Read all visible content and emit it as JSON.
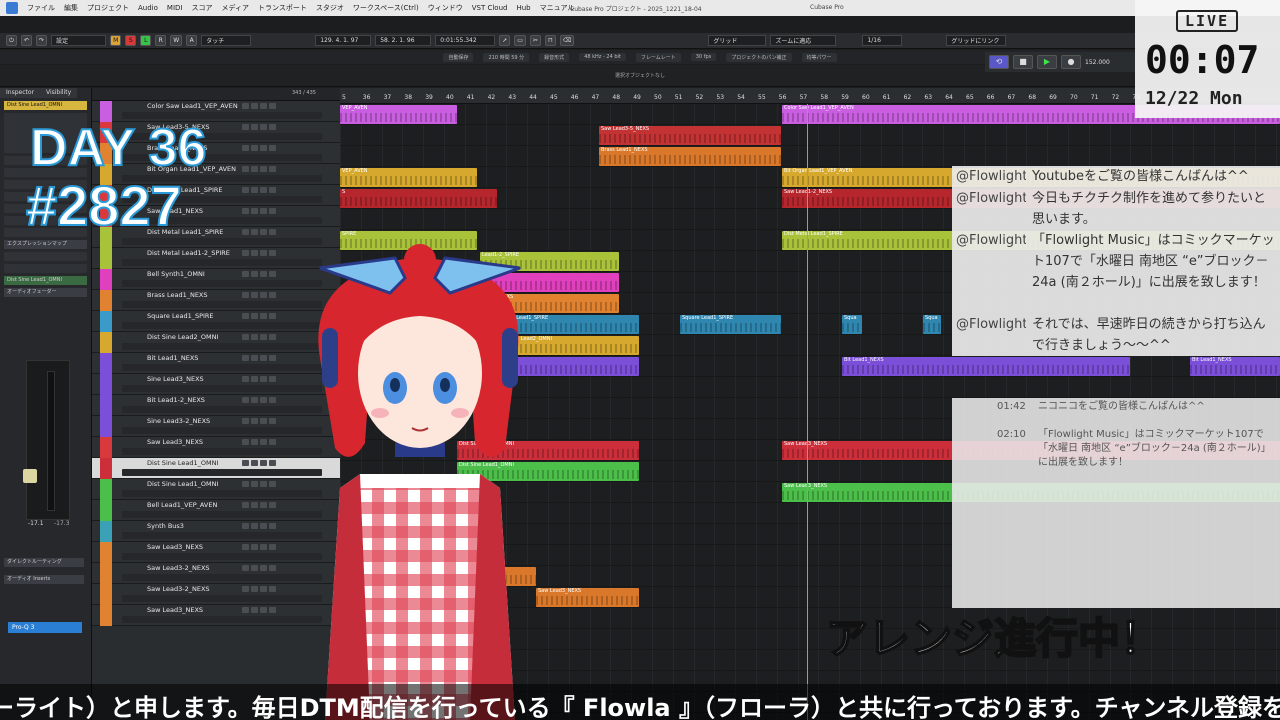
{
  "menubar": {
    "items": [
      "ファイル",
      "編集",
      "プロジェクト",
      "Audio",
      "MIDI",
      "スコア",
      "メディア",
      "トランスポート",
      "スタジオ",
      "ワークスペース(Ctrl)",
      "ウィンドウ",
      "VST Cloud",
      "Hub",
      "マニュアル"
    ]
  },
  "window": {
    "title": "Cubase Pro プロジェクト - 2025_1221_18-04",
    "app": "Cubase Pro"
  },
  "toolbar": {
    "preset": "設定",
    "msb": [
      "M",
      "S",
      "L",
      "R",
      "W",
      "A"
    ],
    "touch": "タッチ",
    "position1": "129. 4. 1. 97",
    "position2": "58. 2. 1. 96",
    "time": "0:01:55.342",
    "grid": "グリッド",
    "zoom": "ズームに適応",
    "quantize": "1/16",
    "grid_link": "グリッドにリンク"
  },
  "infoline": [
    "自動保存",
    "210 時間 59 分",
    "録音形式",
    "48 kHz - 24 bit",
    "フレームレート",
    "30 fps",
    "プロジェクトのパン補正",
    "均等パワー"
  ],
  "selection_hint": "選択オブジェクトなし",
  "inspector": {
    "tab_inspector": "Inspector",
    "tab_visibility": "Visibility",
    "track": "Dist Sine Lead1_OMNI",
    "section_expression": "エクスプレッションマップ",
    "section_quickcontrols": "クイックコントロール",
    "section_fader": "オーディオフェーダー",
    "routing": "ダイレクトルーティング",
    "inserts": "オーディオ Inserts",
    "plugin": "Pro-Q 3",
    "level_l": "-17.1",
    "level_r": "-17.3"
  },
  "tracklist": {
    "counter": "343 / 435",
    "tracks": [
      {
        "name": "Color Saw Lead1_VEP_AVEN",
        "color": "#c95fe0"
      },
      {
        "name": "Saw Lead3-5_NEXS",
        "color": "#d9393c"
      },
      {
        "name": "Brass Lead1_NEXS",
        "color": "#e0822f"
      },
      {
        "name": "Bit Organ Lead1_VEP_AVEN",
        "color": "#d6a92e"
      },
      {
        "name": "Distortion Lead1_SPIRE",
        "color": "#d9393c"
      },
      {
        "name": "Saw Lead1_NEXS",
        "color": "#d9393c"
      },
      {
        "name": "Dist Metal Lead1_SPIRE",
        "color": "#a8c23a"
      },
      {
        "name": "Dist Metal Lead1-2_SPIRE",
        "color": "#a8c23a"
      },
      {
        "name": "Bell Synth1_OMNI",
        "color": "#e03fbd"
      },
      {
        "name": "Brass Lead1_NEXS",
        "color": "#e0822f"
      },
      {
        "name": "Square Lead1_SPIRE",
        "color": "#3a9bc9"
      },
      {
        "name": "Dist Sine Lead2_OMNI",
        "color": "#d6a92e"
      },
      {
        "name": "Bit Lead1_NEXS",
        "color": "#7b4fd8"
      },
      {
        "name": "Sine Lead3_NEXS",
        "color": "#7b4fd8"
      },
      {
        "name": "Bit Lead1-2_NEXS",
        "color": "#7b4fd8"
      },
      {
        "name": "Sine Lead3-2_NEXS",
        "color": "#7b4fd8"
      },
      {
        "name": "Saw Lead3_NEXS",
        "color": "#d9393c"
      },
      {
        "name": "Dist Sine Lead1_OMNI",
        "color": "#cc2f3a"
      },
      {
        "name": "Dist Sine Lead1_OMNI",
        "color": "#4bbf4a"
      },
      {
        "name": "Bell Lead1_VEP_AVEN",
        "color": "#4bbf4a"
      },
      {
        "name": "Synth Bus3",
        "color": "#3aa1b6"
      },
      {
        "name": "Saw Lead3_NEXS",
        "color": "#e0822f"
      },
      {
        "name": "Saw Lead3-2_NEXS",
        "color": "#e0822f"
      },
      {
        "name": "Saw Lead3-2_NEXS",
        "color": "#e0822f"
      },
      {
        "name": "Saw Lead3_NEXS",
        "color": "#e0822f"
      }
    ]
  },
  "ruler": {
    "bars": [
      "5",
      "36",
      "37",
      "38",
      "39",
      "40",
      "41",
      "42",
      "43",
      "44",
      "45",
      "46",
      "47",
      "48",
      "49",
      "50",
      "51",
      "52",
      "53",
      "54",
      "55",
      "56",
      "57",
      "58",
      "59",
      "60",
      "61",
      "62",
      "63",
      "64",
      "65",
      "66",
      "67",
      "68",
      "69",
      "70",
      "71",
      "72",
      "73",
      "74"
    ]
  },
  "clips": [
    {
      "lane": 0,
      "start": 0,
      "len": 117,
      "label": "VEP_AVEN",
      "color": "#c95fe0"
    },
    {
      "lane": 0,
      "start": 442,
      "len": 498,
      "label": "Color Saw Lead1_VEP_AVEN",
      "color": "#c95fe0"
    },
    {
      "lane": 1,
      "start": 259,
      "len": 182,
      "label": "Saw Lead3-5_NEXS",
      "color": "#c33333"
    },
    {
      "lane": 2,
      "start": 259,
      "len": 182,
      "label": "Brass Lead1_NEXS",
      "color": "#d9782a"
    },
    {
      "lane": 3,
      "start": 0,
      "len": 137,
      "label": "VEP_AVEN",
      "color": "#d6a92e"
    },
    {
      "lane": 3,
      "start": 442,
      "len": 498,
      "label": "Bit Organ Lead1_VEP_AVEN",
      "color": "#d6a92e"
    },
    {
      "lane": 4,
      "start": 0,
      "len": 157,
      "label": "S",
      "color": "#b5272d"
    },
    {
      "lane": 4,
      "start": 442,
      "len": 498,
      "label": "Saw Lead1-2_NEXS",
      "color": "#b5272d"
    },
    {
      "lane": 6,
      "start": 0,
      "len": 137,
      "label": "SPIRE",
      "color": "#a8c23a"
    },
    {
      "lane": 6,
      "start": 442,
      "len": 498,
      "label": "Dist Metal Lead1_SPIRE",
      "color": "#a8c23a"
    },
    {
      "lane": 7,
      "start": 140,
      "len": 139,
      "label": "Lead1-2_SPIRE",
      "color": "#a8c23a"
    },
    {
      "lane": 8,
      "start": 140,
      "len": 139,
      "label": "",
      "color": "#e03fbd"
    },
    {
      "lane": 9,
      "start": 140,
      "len": 139,
      "label": "Lead1_NEXS",
      "color": "#e0822f"
    },
    {
      "lane": 10,
      "start": 155,
      "len": 144,
      "label": "Square Lead1_SPIRE",
      "color": "#2f87b0"
    },
    {
      "lane": 10,
      "start": 340,
      "len": 101,
      "label": "Square Lead1_SPIRE",
      "color": "#2f87b0"
    },
    {
      "lane": 10,
      "start": 502,
      "len": 20,
      "label": "Squa",
      "color": "#2f87b0"
    },
    {
      "lane": 10,
      "start": 583,
      "len": 18,
      "label": "Squa",
      "color": "#2f87b0"
    },
    {
      "lane": 11,
      "start": 155,
      "len": 144,
      "label": "Dist Sine Lead2_OMNI",
      "color": "#d6a92e"
    },
    {
      "lane": 12,
      "start": 150,
      "len": 149,
      "label": "",
      "color": "#7b4fd8"
    },
    {
      "lane": 12,
      "start": 502,
      "len": 288,
      "label": "Bit Lead1_NEXS",
      "color": "#7b4fd8"
    },
    {
      "lane": 12,
      "start": 850,
      "len": 90,
      "label": "Bit Lead1_NEXS",
      "color": "#7b4fd8"
    },
    {
      "lane": 16,
      "start": 117,
      "len": 182,
      "label": "Dist Sine Lead1_OMNI",
      "color": "#cc2f3a"
    },
    {
      "lane": 16,
      "start": 442,
      "len": 498,
      "label": "Saw Lead3_NEXS",
      "color": "#cc2f3a"
    },
    {
      "lane": 17,
      "start": 117,
      "len": 182,
      "label": "Dist Sine Lead1_OMNI",
      "color": "#4bbf4a"
    },
    {
      "lane": 18,
      "start": 442,
      "len": 498,
      "label": "Saw Lead3_NEXS",
      "color": "#4bbf4a"
    },
    {
      "lane": 22,
      "start": 120,
      "len": 76,
      "label": "",
      "color": "#d9782a"
    },
    {
      "lane": 23,
      "start": 196,
      "len": 103,
      "label": "Saw Lead3_NEXS",
      "color": "#d9782a"
    }
  ],
  "live": {
    "tag": "LIVE",
    "time": "00:07",
    "date": "12/22 Mon"
  },
  "transport_value": "152.000",
  "overlay": {
    "day": "DAY 36",
    "number": "#2827",
    "banner": "アレンジ進行中！"
  },
  "chat": [
    {
      "user": "@Flowlight",
      "text": "Youtubeをご覧の皆様こんばんは^^"
    },
    {
      "user": "@Flowlight",
      "text": "今日もチクチク制作を進めて参りたいと思います。"
    },
    {
      "user": "@Flowlight",
      "text": "「Flowlight Music」はコミックマーケット107で「水曜日 南地区 “e”ブロック－24a (南２ホール)」に出展を致します！"
    },
    {
      "user": "@Flowlight",
      "text": "それでは、早速昨日の続きから打ち込んで行きましょう～～^^"
    }
  ],
  "nico": [
    {
      "ts": "01:42",
      "text": "ニコニコをご覧の皆様こんばんは^^"
    },
    {
      "ts": "02:10",
      "text": "「Flowlight Music」はコミックマーケット107で「水曜日 南地区 “e”ブロック－24a (南２ホール)」に出展を致します！"
    }
  ],
  "ticker": "ーライト）と申します。毎日DTM配信を行っている『 Flowla 』（フローラ）と共に行っております。チャンネル登録をよろ"
}
